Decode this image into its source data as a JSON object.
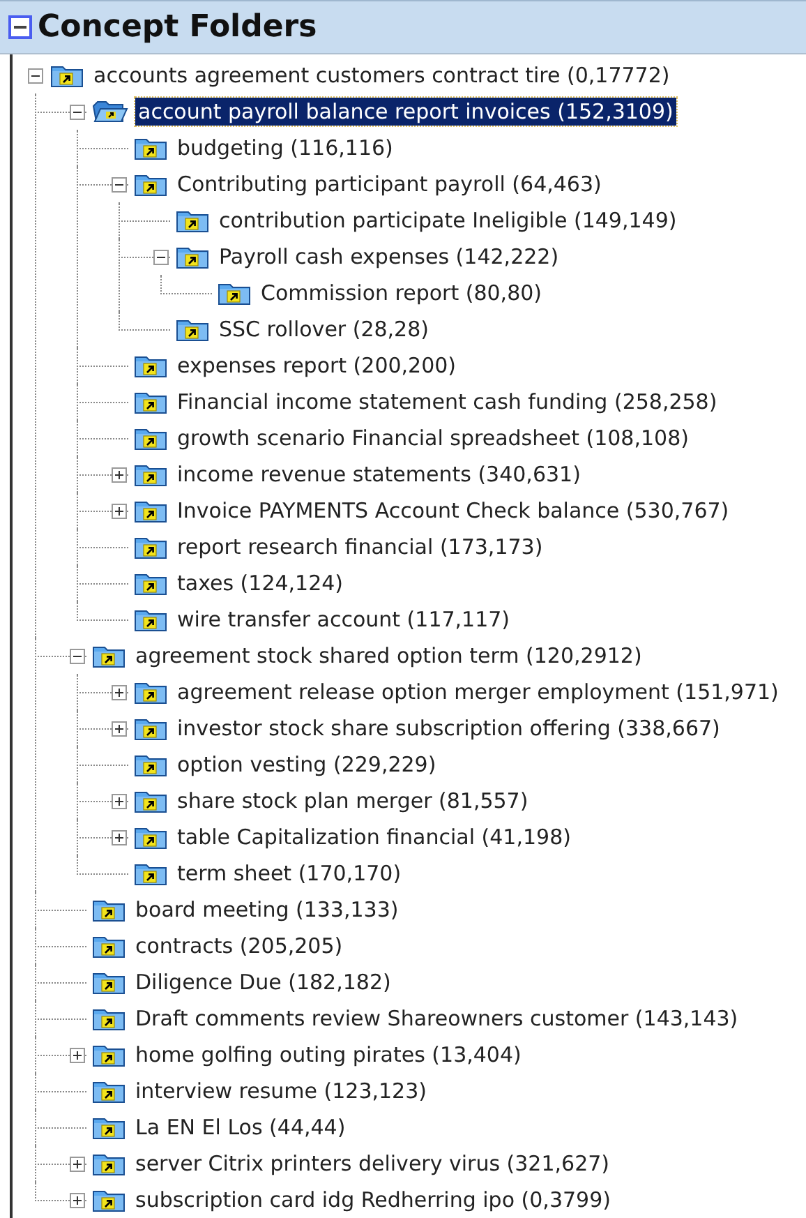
{
  "panel": {
    "title": "Concept Folders",
    "expanded": true
  },
  "tree": [
    {
      "label": "accounts agreement customers contract tire (0,17772)",
      "kind": "branch",
      "expanded": true,
      "selected": false,
      "children": [
        {
          "label": "account payroll balance report invoices (152,3109)",
          "kind": "branch",
          "expanded": true,
          "selected": true,
          "children": [
            {
              "label": "budgeting (116,116)",
              "kind": "leaf",
              "selected": false
            },
            {
              "label": "Contributing participant payroll (64,463)",
              "kind": "branch",
              "expanded": true,
              "selected": false,
              "children": [
                {
                  "label": "contribution participate Ineligible (149,149)",
                  "kind": "leaf",
                  "selected": false
                },
                {
                  "label": "Payroll cash expenses (142,222)",
                  "kind": "branch",
                  "expanded": true,
                  "selected": false,
                  "children": [
                    {
                      "label": "Commission report (80,80)",
                      "kind": "leaf",
                      "selected": false
                    }
                  ]
                },
                {
                  "label": "SSC rollover (28,28)",
                  "kind": "leaf",
                  "selected": false
                }
              ]
            },
            {
              "label": "expenses report (200,200)",
              "kind": "leaf",
              "selected": false
            },
            {
              "label": "Financial income statement cash funding (258,258)",
              "kind": "leaf",
              "selected": false
            },
            {
              "label": "growth scenario Financial spreadsheet (108,108)",
              "kind": "leaf",
              "selected": false
            },
            {
              "label": "income revenue statements (340,631)",
              "kind": "branch",
              "expanded": false,
              "selected": false
            },
            {
              "label": "Invoice PAYMENTS Account Check balance (530,767)",
              "kind": "branch",
              "expanded": false,
              "selected": false
            },
            {
              "label": "report research financial (173,173)",
              "kind": "leaf",
              "selected": false
            },
            {
              "label": "taxes (124,124)",
              "kind": "leaf",
              "selected": false
            },
            {
              "label": "wire transfer account (117,117)",
              "kind": "leaf",
              "selected": false
            }
          ]
        },
        {
          "label": "agreement stock shared option term (120,2912)",
          "kind": "branch",
          "expanded": true,
          "selected": false,
          "children": [
            {
              "label": "agreement release option merger employment (151,971)",
              "kind": "branch",
              "expanded": false,
              "selected": false
            },
            {
              "label": "investor stock share subscription offering (338,667)",
              "kind": "branch",
              "expanded": false,
              "selected": false
            },
            {
              "label": "option vesting (229,229)",
              "kind": "leaf",
              "selected": false
            },
            {
              "label": "share stock plan merger (81,557)",
              "kind": "branch",
              "expanded": false,
              "selected": false
            },
            {
              "label": "table Capitalization financial (41,198)",
              "kind": "branch",
              "expanded": false,
              "selected": false
            },
            {
              "label": "term sheet (170,170)",
              "kind": "leaf",
              "selected": false
            }
          ]
        },
        {
          "label": "board meeting (133,133)",
          "kind": "leaf",
          "selected": false
        },
        {
          "label": "contracts (205,205)",
          "kind": "leaf",
          "selected": false
        },
        {
          "label": "Diligence Due (182,182)",
          "kind": "leaf",
          "selected": false
        },
        {
          "label": "Draft comments review Shareowners customer (143,143)",
          "kind": "leaf",
          "selected": false
        },
        {
          "label": "home golfing outing pirates (13,404)",
          "kind": "branch",
          "expanded": false,
          "selected": false
        },
        {
          "label": "interview resume (123,123)",
          "kind": "leaf",
          "selected": false
        },
        {
          "label": "La EN El Los (44,44)",
          "kind": "leaf",
          "selected": false
        },
        {
          "label": "server Citrix printers delivery virus (321,627)",
          "kind": "branch",
          "expanded": false,
          "selected": false
        },
        {
          "label": "subscription card idg Redherring ipo (0,3799)",
          "kind": "branch",
          "expanded": false,
          "selected": false
        }
      ]
    }
  ]
}
